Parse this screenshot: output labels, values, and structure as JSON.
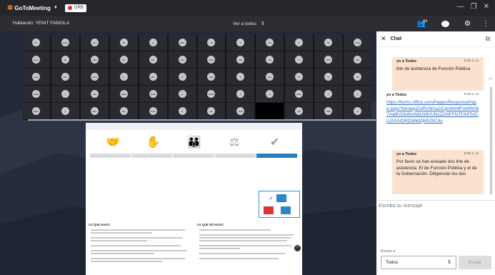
{
  "app": {
    "logo": "GoToMeeting",
    "record_label": "GRB"
  },
  "toolbar": {
    "talking": "Hablando: YENIT FABIOLA",
    "view_all": "Ver a todos",
    "attendee_count": "64"
  },
  "grid": {
    "rows": [
      [
        "NL",
        "HHN",
        "GN",
        "VD",
        "G",
        "HRN",
        "LR",
        "C",
        "CRL",
        "F",
        "CIL",
        "FUHI"
      ],
      [
        "PGH",
        "SC",
        "LRG",
        "RN",
        "MD",
        "LRC",
        "DHH",
        "DE",
        "SH",
        "A",
        "HOC",
        "PJR"
      ],
      [
        "CHR",
        "MG",
        "PGH",
        "E",
        "LBA",
        "E",
        "HRL",
        "E",
        "CCL",
        "IP",
        "S",
        "LR"
      ],
      [
        "HSM",
        "C",
        "NR",
        "MSE",
        "3A3P",
        "E",
        "XDCH",
        "C",
        "D",
        "DRV",
        "A",
        "C"
      ],
      [
        "DEIL",
        "A",
        "DRL",
        "RH",
        "VALP",
        "G",
        "RC",
        "SOD",
        "",
        "TCI",
        "HBD",
        "R"
      ]
    ]
  },
  "doc": {
    "col_left_title": "LO QUE HAGO",
    "col_right_title": "LO QUE NO HAGO"
  },
  "chat": {
    "title": "Chat",
    "messages": [
      {
        "from": "yo a Todos",
        "time": "9:46 a. m.",
        "text": "link de asistencia de Función Pública"
      },
      {
        "from": "yo a Todos",
        "time": "9:46 a. m.",
        "text": "https://forms.office.com/Pages/ResponsePage.aspx?id=wqoDVRV6r0a1lCpnWtHfFmHW087AwBVDkWsIIWUlr8VUNzZGNFFNTFA4TkICUJVVUDROWktIQkRJSC4u"
      },
      {
        "from": "yo a Todos",
        "time": "9:56 a. m.",
        "text": "Por favor se han enviado dos link de asistencia. El de Función Pública y el de la Gobernación. Diligenciar los dos"
      }
    ],
    "compose_placeholder": "Escriba su mensaje",
    "send_to_label": "Enviar a",
    "send_to_value": "Todos",
    "send_label": "Enviar"
  }
}
